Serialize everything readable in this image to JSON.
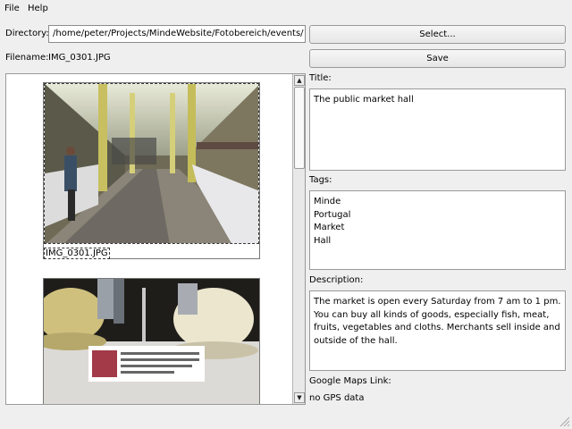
{
  "menu": {
    "file": "File",
    "help": "Help"
  },
  "directory": {
    "label": "Directory:",
    "value": "/home/peter/Projects/MindeWebsite/Fotobereich/events/"
  },
  "filename": {
    "label": "Filename:",
    "value": "IMG_0301.JPG"
  },
  "buttons": {
    "select": "Select...",
    "save": "Save"
  },
  "title": {
    "label": "Title:",
    "value": "The public market hall"
  },
  "tags": {
    "label": "Tags:",
    "items": [
      "Minde",
      "Portugal",
      "Market",
      "Hall"
    ]
  },
  "description": {
    "label": "Description:",
    "value": "The market is open every Saturday from 7 am to 1 pm. You can buy all kinds of goods, especially fish, meat, fruits, vegetables and cloths. Merchants sell inside and outside of the hall."
  },
  "maps": {
    "label": "Google Maps Link:",
    "value": "no GPS data"
  },
  "thumbnails": [
    {
      "caption": "IMG_0301.JPG"
    }
  ],
  "icons": {
    "scroll_up": "triangle-up",
    "scroll_down": "triangle-down"
  }
}
